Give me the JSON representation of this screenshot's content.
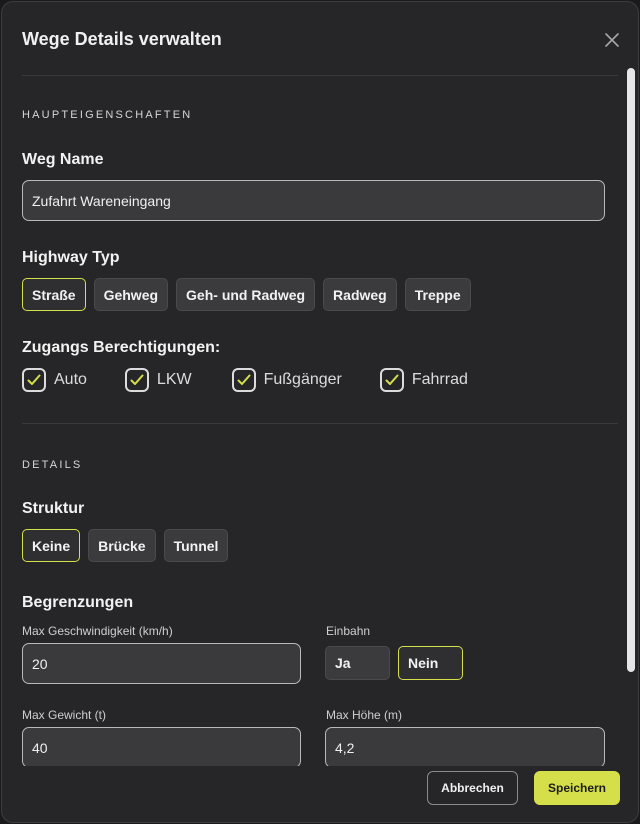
{
  "dialog": {
    "title": "Wege Details verwalten"
  },
  "main_section": {
    "label": "HAUPTEIGENSCHAFTEN"
  },
  "name_field": {
    "title": "Weg Name",
    "value": "Zufahrt Wareneingang"
  },
  "highway": {
    "title": "Highway Typ",
    "options": [
      "Straße",
      "Gehweg",
      "Geh- und Radweg",
      "Radweg",
      "Treppe"
    ],
    "selected": "Straße"
  },
  "access": {
    "title": "Zugangs Berechtigungen:",
    "items": [
      {
        "label": "Auto",
        "checked": true
      },
      {
        "label": "LKW",
        "checked": true
      },
      {
        "label": "Fußgänger",
        "checked": true
      },
      {
        "label": "Fahrrad",
        "checked": true
      }
    ]
  },
  "details_section": {
    "label": "DETAILS"
  },
  "structure": {
    "title": "Struktur",
    "options": [
      "Keine",
      "Brücke",
      "Tunnel"
    ],
    "selected": "Keine"
  },
  "limits": {
    "title": "Begrenzungen",
    "max_speed": {
      "label": "Max Geschwindigkeit (km/h)",
      "value": "20"
    },
    "oneway": {
      "label": "Einbahn",
      "options": [
        "Ja",
        "Nein"
      ],
      "selected": "Nein"
    },
    "max_weight": {
      "label": "Max Gewicht (t)",
      "value": "40"
    },
    "max_height": {
      "label": "Max Höhe (m)",
      "value": "4,2"
    }
  },
  "footer": {
    "cancel_label": "Abbrechen",
    "save_label": "Speichern"
  },
  "colors": {
    "accent": "#d5df4a",
    "background": "#262628",
    "input": "#3a3a3d"
  },
  "icons": {
    "close": "close-icon",
    "check": "checkmark-icon"
  }
}
